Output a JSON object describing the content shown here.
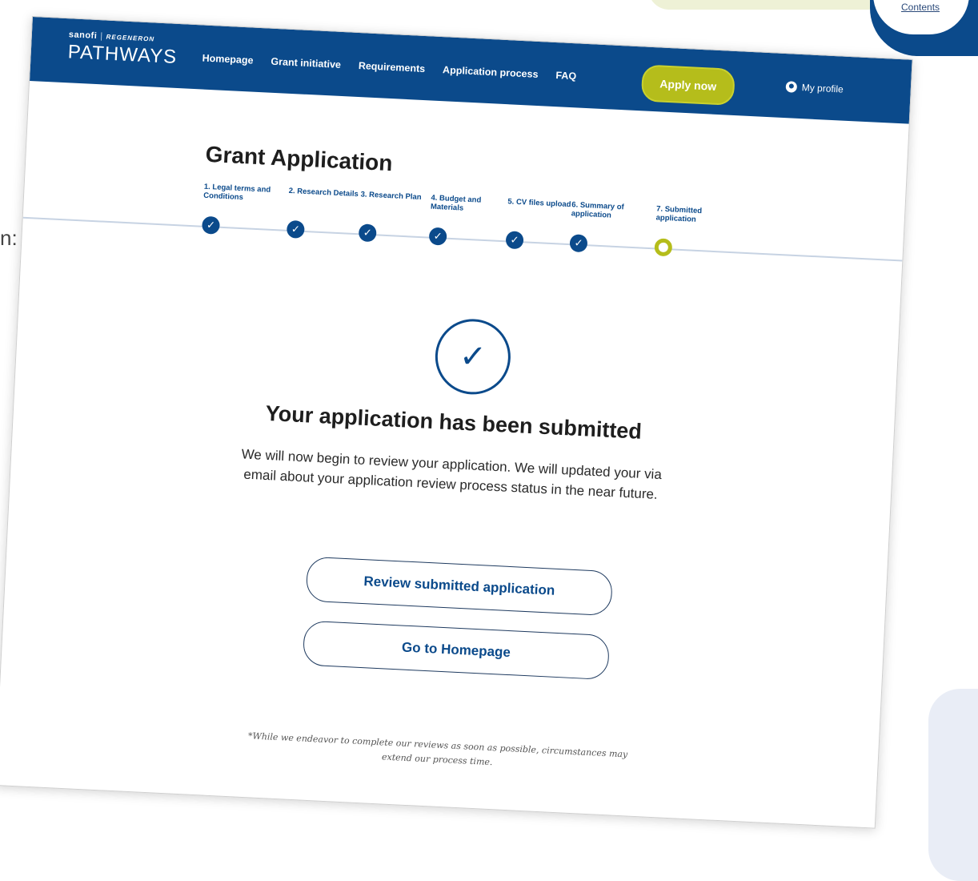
{
  "background": {
    "side_text": "n:",
    "toc_link": "Contents"
  },
  "nav": {
    "brand_top_left": "sanofi",
    "brand_top_right": "REGENERON",
    "brand_main": "PATHWAYS",
    "links": [
      "Homepage",
      "Grant initiative",
      "Requirements",
      "Application process",
      "FAQ"
    ],
    "apply_label": "Apply now",
    "profile_label": "My profile"
  },
  "page": {
    "title": "Grant Application",
    "steps": [
      {
        "label": "1. Legal terms and Conditions",
        "status": "done"
      },
      {
        "label": "2. Research Details",
        "status": "done"
      },
      {
        "label": "3. Research Plan",
        "status": "done"
      },
      {
        "label": "4. Budget and Materials",
        "status": "done"
      },
      {
        "label": "5. CV files upload",
        "status": "done"
      },
      {
        "label": "6. Summary of application",
        "status": "done"
      },
      {
        "label": "7. Submitted application",
        "status": "current"
      }
    ],
    "success_heading": "Your application has been submitted",
    "success_body": "We will now begin to review your application. We will updated your via email about your application review process status in the near future.",
    "review_button": "Review submitted application",
    "home_button": "Go to Homepage",
    "footnote": "*While we endeavor to complete our reviews as soon as possible, circumstances may extend our process time."
  },
  "colors": {
    "brand_blue": "#0b4a8b",
    "accent_lime": "#b5bd1b"
  }
}
